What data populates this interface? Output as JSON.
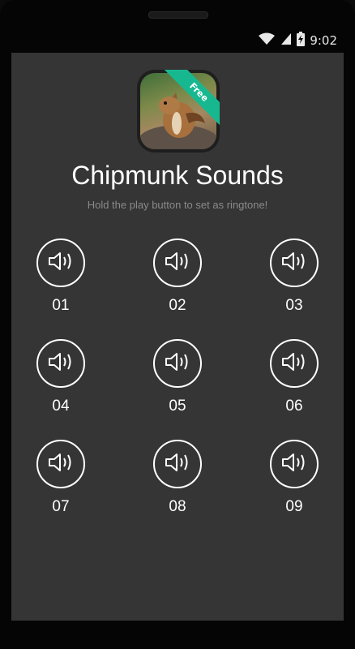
{
  "status_bar": {
    "time": "9:02",
    "wifi_icon": "wifi-icon",
    "signal_icon": "cell-signal-icon",
    "battery_icon": "battery-charging-icon"
  },
  "app": {
    "title": "Chipmunk Sounds",
    "subtitle": "Hold the play button to set as ringtone!",
    "badge": "Free"
  },
  "sounds": [
    {
      "label": "01",
      "icon": "speaker-icon"
    },
    {
      "label": "02",
      "icon": "speaker-icon"
    },
    {
      "label": "03",
      "icon": "speaker-icon"
    },
    {
      "label": "04",
      "icon": "speaker-icon"
    },
    {
      "label": "05",
      "icon": "speaker-icon"
    },
    {
      "label": "06",
      "icon": "speaker-icon"
    },
    {
      "label": "07",
      "icon": "speaker-icon"
    },
    {
      "label": "08",
      "icon": "speaker-icon"
    },
    {
      "label": "09",
      "icon": "speaker-icon"
    }
  ]
}
